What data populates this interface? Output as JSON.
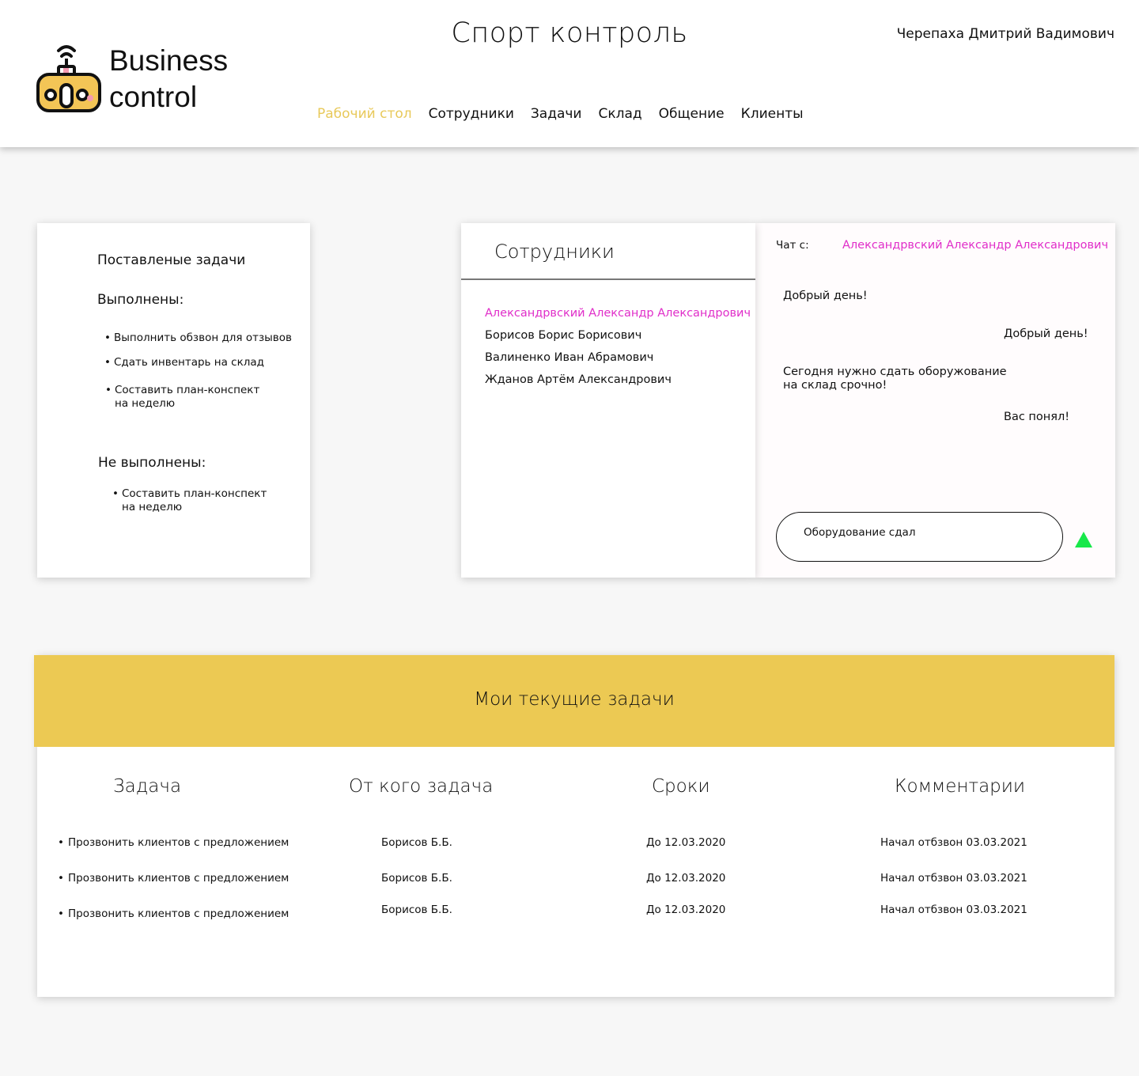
{
  "header": {
    "brand_line1": "Business",
    "brand_line2": "control",
    "site_title": "Спорт контроль",
    "user_name": "Черепаха Дмитрий Вадимович",
    "nav": [
      {
        "label": "Рабочий стол",
        "active": true
      },
      {
        "label": "Сотрудники",
        "active": false
      },
      {
        "label": "Задачи",
        "active": false
      },
      {
        "label": "Склад",
        "active": false
      },
      {
        "label": "Общение",
        "active": false
      },
      {
        "label": "Клиенты",
        "active": false
      }
    ],
    "accent_color": "#e8c95a",
    "logo_icon": "robot-controller-icon"
  },
  "tasks_panel": {
    "title": "Поставленые задачи",
    "done_heading": "Выполнены:",
    "done": [
      "Выполнить обзвон для отзывов",
      "Сдать инвентарь на склад",
      "Составить план-конспект\nна неделю"
    ],
    "not_done_heading": "Не выполнены:",
    "not_done": [
      "Составить план-конспект\nна неделю"
    ],
    "bullet": "•"
  },
  "employees_panel": {
    "title": "Сотрудники",
    "items": [
      "Александрвский Александр Александрович",
      "Борисов Борис Борисович",
      "Валиненко Иван Абрамович",
      "Жданов Артём Александрович"
    ],
    "selected_color": "#e02ec9"
  },
  "chat": {
    "with_label": "Чат с:",
    "with_name": "Александрвский Александр Александрович",
    "messages": [
      {
        "from": "them",
        "text": "Добрый день!"
      },
      {
        "from": "me",
        "text": "Добрый день!"
      },
      {
        "from": "them",
        "text": "Сегодня нужно сдать оборужование\nна склад срочно!"
      },
      {
        "from": "me",
        "text": "Вас понял!"
      }
    ],
    "input_value": "Оборудование сдал",
    "send_icon": "send-triangle-icon",
    "send_color": "#18e84a"
  },
  "current_tasks": {
    "banner_title": "Мои текущие задачи",
    "banner_color": "#ecc953",
    "columns": [
      "Задача",
      "От кого задача",
      "Сроки",
      "Комментарии"
    ],
    "rows": [
      {
        "task": "Прозвонить клиентов с предложением",
        "from": "Борисов Б.Б.",
        "deadline": "До 12.03.2020",
        "comment": "Начал отбзвон 03.03.2021"
      },
      {
        "task": "Прозвонить клиентов с предложением",
        "from": "Борисов Б.Б.",
        "deadline": "До 12.03.2020",
        "comment": "Начал отбзвон 03.03.2021"
      },
      {
        "task": "Прозвонить клиентов с предложением",
        "from": "Борисов Б.Б.",
        "deadline": "До 12.03.2020",
        "comment": "Начал отбзвон 03.03.2021"
      }
    ]
  }
}
